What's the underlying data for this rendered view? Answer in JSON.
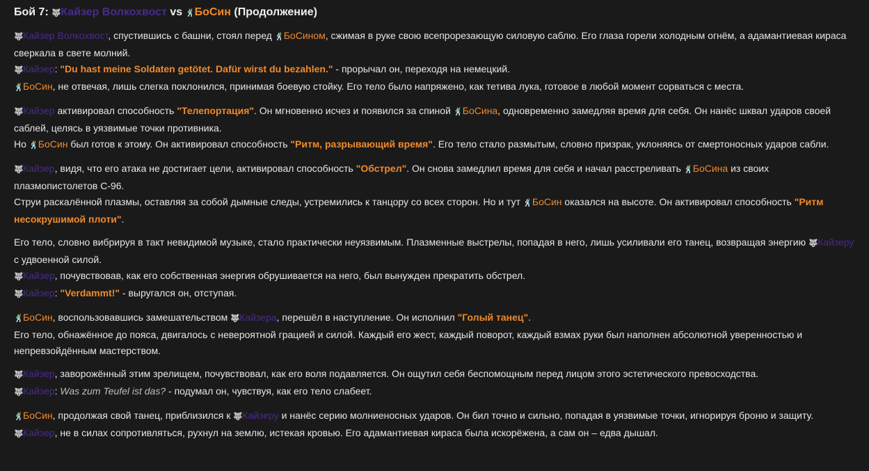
{
  "colors": {
    "kaiser": "#4a2a8a",
    "bosin": "#f08a2a",
    "quote": "#f08a2a",
    "text": "#e6e6e6",
    "bg": "#1a1a1a"
  },
  "icons": {
    "kaiser": "wolf-icon",
    "bosin": "dancer-icon"
  },
  "title": {
    "prefix": "Бой 7:",
    "kaiser": "Кайзер Волкохвост",
    "vs": "vs",
    "bosin": "БоСин",
    "suffix": "(Продолжение)"
  },
  "paragraphs": [
    {
      "lines": [
        [
          {
            "t": "k",
            "v": "Кайзер Волкохвост"
          },
          {
            "t": "n",
            "v": ", спустившись с башни, стоял перед "
          },
          {
            "t": "b",
            "v": "БоСином"
          },
          {
            "t": "n",
            "v": ", сжимая в руке свою всепрорезающую силовую саблю. Его глаза горели холодным огнём, а адамантиевая кираса сверкала в свете молний."
          }
        ],
        [
          {
            "t": "k",
            "v": "Кайзер"
          },
          {
            "t": "n",
            "v": ": "
          },
          {
            "t": "q",
            "v": "\"Du hast meine Soldaten getötet. Dafür wirst du bezahlen.\""
          },
          {
            "t": "n",
            "v": " - прорычал он, переходя на немецкий."
          }
        ],
        [
          {
            "t": "b",
            "v": "БоСин"
          },
          {
            "t": "n",
            "v": ", не отвечая, лишь слегка поклонился, принимая боевую стойку. Его тело было напряжено, как тетива лука, готовое в любой момент сорваться с места."
          }
        ]
      ]
    },
    {
      "lines": [
        [
          {
            "t": "k",
            "v": "Кайзер"
          },
          {
            "t": "n",
            "v": " активировал способность "
          },
          {
            "t": "q",
            "v": "\"Телепортация\""
          },
          {
            "t": "n",
            "v": ". Он мгновенно исчез и появился за спиной "
          },
          {
            "t": "b",
            "v": "БоСина"
          },
          {
            "t": "n",
            "v": ", одновременно замедляя время для себя. Он нанёс шквал ударов своей саблей, целясь в уязвимые точки противника."
          }
        ],
        [
          {
            "t": "n",
            "v": "Но "
          },
          {
            "t": "b",
            "v": "БоСин"
          },
          {
            "t": "n",
            "v": " был готов к этому. Он активировал способность "
          },
          {
            "t": "q",
            "v": "\"Ритм, разрывающий время\""
          },
          {
            "t": "n",
            "v": ". Его тело стало размытым, словно призрак, уклоняясь от смертоносных ударов сабли."
          }
        ]
      ]
    },
    {
      "lines": [
        [
          {
            "t": "k",
            "v": "Кайзер"
          },
          {
            "t": "n",
            "v": ", видя, что его атака не достигает цели, активировал способность "
          },
          {
            "t": "q",
            "v": "\"Обстрел\""
          },
          {
            "t": "n",
            "v": ". Он снова замедлил время для себя и начал расстреливать "
          },
          {
            "t": "b",
            "v": "БоСина"
          },
          {
            "t": "n",
            "v": " из своих плазмопистолетов С-96."
          }
        ],
        [
          {
            "t": "n",
            "v": "Струи раскалённой плазмы, оставляя за собой дымные следы, устремились к танцору со всех сторон. Но и тут "
          },
          {
            "t": "b",
            "v": "БоСин"
          },
          {
            "t": "n",
            "v": " оказался на высоте. Он активировал способность "
          },
          {
            "t": "q",
            "v": "\"Ритм несокрушимой плоти\""
          },
          {
            "t": "n",
            "v": "."
          }
        ]
      ]
    },
    {
      "lines": [
        [
          {
            "t": "n",
            "v": "Его тело, словно вибрируя в такт невидимой музыке, стало практически неуязвимым. Плазменные выстрелы, попадая в него, лишь усиливали его танец, возвращая энергию "
          },
          {
            "t": "k",
            "v": "Кайзеру"
          },
          {
            "t": "n",
            "v": " с удвоенной силой."
          }
        ],
        [
          {
            "t": "k",
            "v": "Кайзер"
          },
          {
            "t": "n",
            "v": ", почувствовав, как его собственная энергия обрушивается на него, был вынужден прекратить обстрел."
          }
        ],
        [
          {
            "t": "k",
            "v": "Кайзер"
          },
          {
            "t": "n",
            "v": ": "
          },
          {
            "t": "q",
            "v": "\"Verdammt!\""
          },
          {
            "t": "n",
            "v": " - выругался он, отступая."
          }
        ]
      ]
    },
    {
      "lines": [
        [
          {
            "t": "b",
            "v": "БоСин"
          },
          {
            "t": "n",
            "v": ", воспользовавшись замешательством "
          },
          {
            "t": "k",
            "v": "Кайзера"
          },
          {
            "t": "n",
            "v": ", перешёл в наступление. Он исполнил "
          },
          {
            "t": "q",
            "v": "\"Голый танец\""
          },
          {
            "t": "n",
            "v": "."
          }
        ],
        [
          {
            "t": "n",
            "v": "Его тело, обнажённое до пояса, двигалось с невероятной грацией и силой. Каждый его жест, каждый поворот, каждый взмах руки был наполнен абсолютной уверенностью и непревзойдённым мастерством."
          }
        ]
      ]
    },
    {
      "lines": [
        [
          {
            "t": "k",
            "v": "Кайзер"
          },
          {
            "t": "n",
            "v": ", заворожённый этим зрелищем, почувствовал, как его воля подавляется. Он ощутил себя беспомощным перед лицом этого эстетического превосходства."
          }
        ],
        [
          {
            "t": "k",
            "v": "Кайзер"
          },
          {
            "t": "n",
            "v": ": "
          },
          {
            "t": "i",
            "v": "Was zum Teufel ist das?"
          },
          {
            "t": "n",
            "v": " - подумал он, чувствуя, как его тело слабеет."
          }
        ]
      ]
    },
    {
      "lines": [
        [
          {
            "t": "b",
            "v": "БоСин"
          },
          {
            "t": "n",
            "v": ", продолжая свой танец, приблизился к "
          },
          {
            "t": "k",
            "v": "Кайзеру"
          },
          {
            "t": "n",
            "v": " и нанёс серию молниеносных ударов. Он бил точно и сильно, попадая в уязвимые точки, игнорируя броню и защиту."
          }
        ],
        [
          {
            "t": "k",
            "v": "Кайзер"
          },
          {
            "t": "n",
            "v": ", не в силах сопротивляться, рухнул на землю, истекая кровью. Его адамантиевая кираса была искорёжена, а сам он – едва дышал."
          }
        ]
      ]
    }
  ]
}
